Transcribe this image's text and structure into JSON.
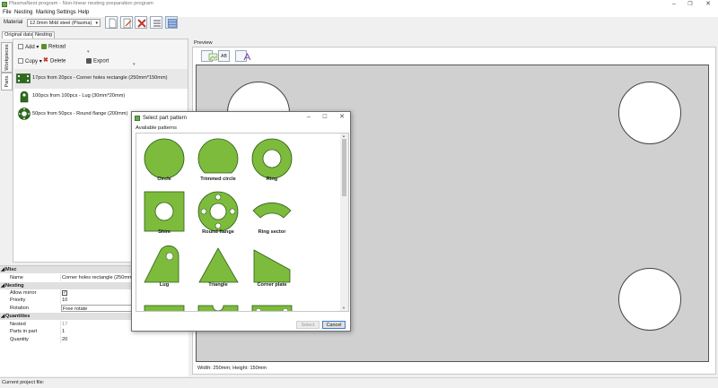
{
  "window": {
    "title": "PlasmaNest program - Non-linear nesting preparation program",
    "controls": [
      "–",
      "❐",
      "✕"
    ]
  },
  "menu": [
    "File",
    "Nesting",
    "Marking",
    "Settings",
    "Help"
  ],
  "toolbar": {
    "material_label": "Material",
    "material_value": "12.0mm Mild steel (Plasma)"
  },
  "tabs": [
    "Original data",
    "Nesting"
  ],
  "side_tabs": [
    "Workpieces",
    "Parts"
  ],
  "parts_toolbar": {
    "add": "Add",
    "reload": "Reload",
    "copy": "Copy",
    "delete": "Delete",
    "export": "Export"
  },
  "parts": [
    {
      "label": "17pcs from 20pcs - Corner holes rectangle (250mm*150mm)"
    },
    {
      "label": "100pcs from 100pcs - Lug (30mm*20mm)"
    },
    {
      "label": "50pcs from 50pcs - Round flange (200mm)"
    }
  ],
  "properties": {
    "misc": {
      "header": "Misc",
      "name_key": "Name",
      "name_value": "Corner holes rectangle (250mm*150mm)"
    },
    "nesting": {
      "header": "Nesting",
      "allow_mirror_key": "Allow mirror",
      "allow_mirror_value": "✓",
      "priority_key": "Priority",
      "priority_value": "10",
      "rotation_key": "Rotation",
      "rotation_value": "Free rotate"
    },
    "quantities": {
      "header": "Quantities",
      "nested_key": "Nested",
      "nested_value": "17",
      "parts_in_part_key": "Parts in part",
      "parts_in_part_value": "1",
      "quantity_key": "Quantity",
      "quantity_value": "20"
    }
  },
  "preview": {
    "label": "Preview",
    "btn_ab": "AB",
    "dimensions": "Width: 250mm; Height: 150mm"
  },
  "status": {
    "text": "Current project file:"
  },
  "dialog": {
    "title": "Select part pattern",
    "subtitle": "Available patterns",
    "patterns": [
      "Circle",
      "Trimmed circle",
      "Ring",
      "Shim",
      "Round flange",
      "Ring sector",
      "Lug",
      "Triangle",
      "Corner plate"
    ],
    "select_button": "Select",
    "cancel_button": "Cancel"
  },
  "colors": {
    "part_fill": "#7dbb3c",
    "part_stroke": "#2e5e17",
    "canvas": "#d0d0d0"
  }
}
